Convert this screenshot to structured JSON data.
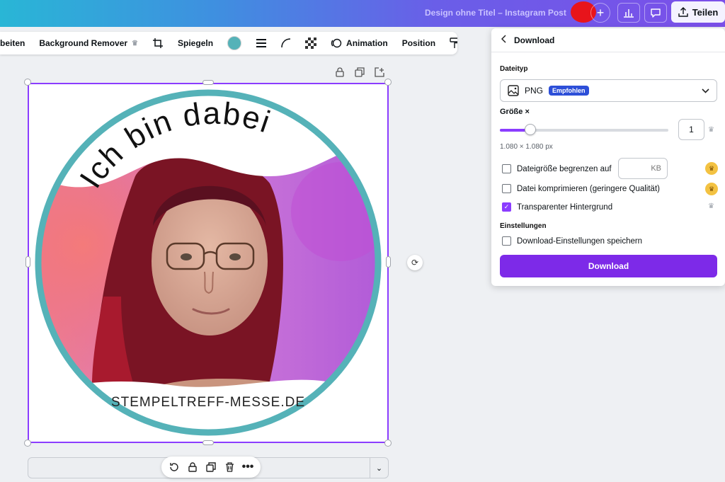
{
  "topbar": {
    "doc_title": "Design ohne Titel – Instagram Post",
    "plus_label": "+",
    "share_label": "Teilen"
  },
  "toolbar": {
    "edit_label": "beiten",
    "bg_remover_label": "Background Remover",
    "flip_label": "Spiegeln",
    "animation_label": "Animation",
    "position_label": "Position"
  },
  "canvas": {
    "top_text": "Ich bin dabei",
    "bottom_text": "STEMPELTREFF-MESSE.DE"
  },
  "panel": {
    "title": "Download",
    "filetype_label": "Dateityp",
    "filetype_value": "PNG",
    "filetype_badge": "Empfohlen",
    "size_label": "Größe ×",
    "size_value": "1",
    "size_fraction": 0.18,
    "dimensions": "1.080 × 1.080 px",
    "limit_label": "Dateigröße begrenzen auf",
    "limit_unit": "KB",
    "compress_label": "Datei komprimieren (geringere Qualität)",
    "transparent_label": "Transparenter Hintergrund",
    "settings_label": "Einstellungen",
    "save_settings_label": "Download-Einstellungen speichern",
    "download_label": "Download"
  },
  "colors": {
    "accent": "#8b3dff",
    "download_button": "#7d2ae8",
    "ring": "#55b2b8"
  }
}
